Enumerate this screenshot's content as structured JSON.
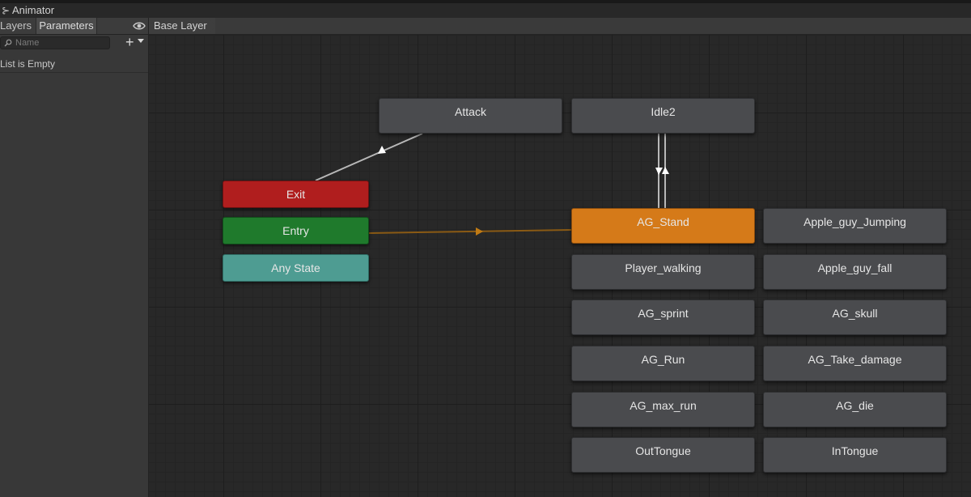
{
  "window": {
    "title": "Animator"
  },
  "sidebar": {
    "tabs": [
      {
        "label": "Layers"
      },
      {
        "label": "Parameters"
      }
    ],
    "active_tab": "Parameters",
    "search": {
      "placeholder": "Name",
      "value": ""
    },
    "add_icon": "plus-icon",
    "empty_message": "List is Empty"
  },
  "breadcrumb": {
    "label": "Base Layer"
  },
  "colors": {
    "exit": "#b01e1e",
    "entry": "#1f7a2c",
    "any_state": "#4e9c92",
    "default_state": "#d57a19",
    "state": "#4a4b4e",
    "entry_transition": "#a0620f"
  },
  "states": {
    "attack": "Attack",
    "idle2": "Idle2",
    "exit": "Exit",
    "entry": "Entry",
    "any_state": "Any State",
    "ag_stand": "AG_Stand",
    "apple_guy_jumping": "Apple_guy_Jumping",
    "player_walking": "Player_walking",
    "apple_guy_fall": "Apple_guy_fall",
    "ag_sprint": "AG_sprint",
    "ag_skull": "AG_skull",
    "ag_run": "AG_Run",
    "ag_take_damage": "AG_Take_damage",
    "ag_max_run": "AG_max_run",
    "ag_die": "AG_die",
    "outtongue": "OutTongue",
    "intongue": "InTongue"
  },
  "default_state": "AG_Stand",
  "transitions": [
    {
      "from": "Exit",
      "to": "Attack"
    },
    {
      "from": "AG_Stand",
      "to": "Idle2"
    },
    {
      "from": "Idle2",
      "to": "AG_Stand"
    },
    {
      "from": "Entry",
      "to": "AG_Stand"
    }
  ]
}
